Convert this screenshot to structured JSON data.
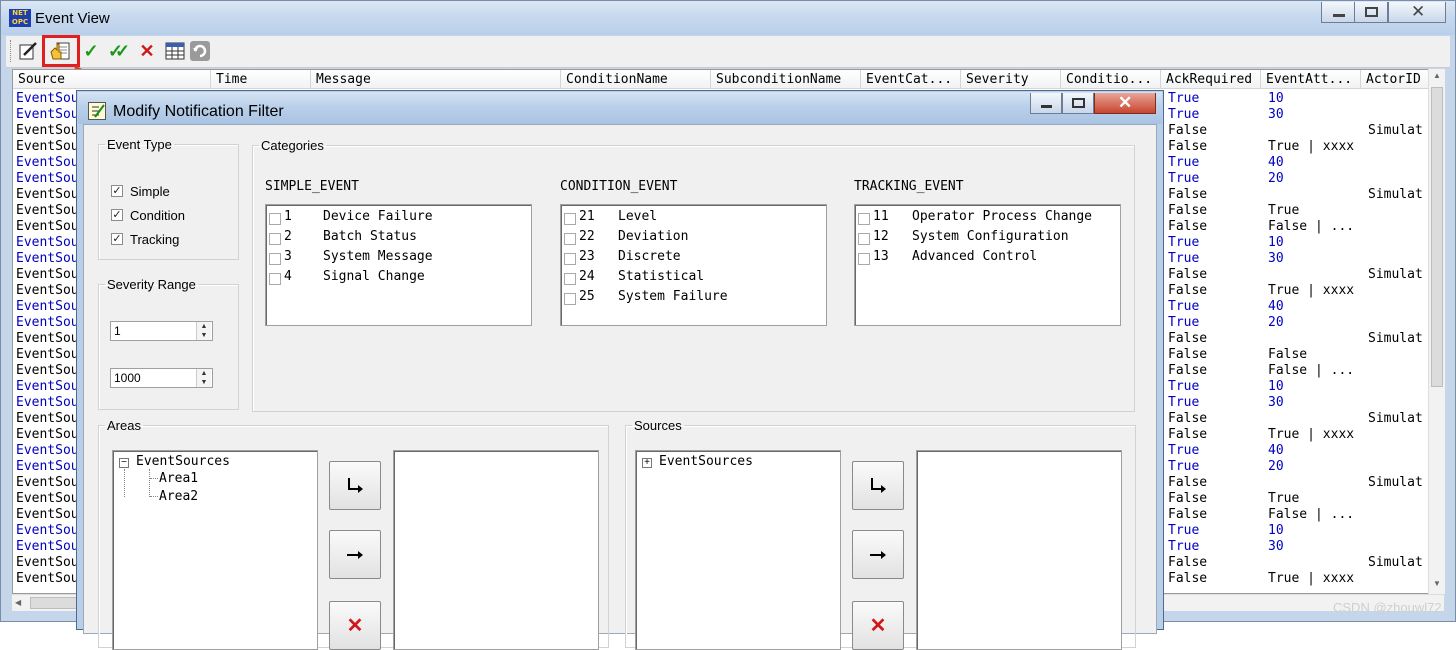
{
  "window": {
    "title": "Event View",
    "logo_text": "NET OPC",
    "minimize_icon": "minimize-icon",
    "maximize_icon": "maximize-icon",
    "close_icon": "close-icon"
  },
  "toolbar": {
    "icons": [
      "edit-icon",
      "filter-hand-icon",
      "check-icon",
      "double-check-icon",
      "delete-icon",
      "grid-icon",
      "refresh-icon"
    ]
  },
  "grid": {
    "columns": [
      "Source",
      "Time",
      "Message",
      "ConditionName",
      "SubconditionName",
      "EventCat...",
      "Severity",
      "Conditio...",
      "AckRequired",
      "EventAtt...",
      "ActorID"
    ],
    "rows": [
      {
        "source": "EventSou",
        "ack": "True",
        "attr": "10",
        "actor": "",
        "blue": true
      },
      {
        "source": "EventSou",
        "ack": "True",
        "attr": "30",
        "actor": "",
        "blue": true
      },
      {
        "source": "EventSou",
        "ack": "False",
        "attr": "",
        "actor": "Simulat",
        "blue": false
      },
      {
        "source": "EventSou",
        "ack": "False",
        "attr": "True | xxxx",
        "actor": "",
        "blue": false
      },
      {
        "source": "EventSou",
        "ack": "True",
        "attr": "40",
        "actor": "",
        "blue": true
      },
      {
        "source": "EventSou",
        "ack": "True",
        "attr": "20",
        "actor": "",
        "blue": true
      },
      {
        "source": "EventSou",
        "ack": "False",
        "attr": "",
        "actor": "Simulat",
        "blue": false
      },
      {
        "source": "EventSou",
        "ack": "False",
        "attr": "True",
        "actor": "",
        "blue": false
      },
      {
        "source": "EventSou",
        "ack": "False",
        "attr": "False | ...",
        "actor": "",
        "blue": false
      },
      {
        "source": "EventSou",
        "ack": "True",
        "attr": "10",
        "actor": "",
        "blue": true
      },
      {
        "source": "EventSou",
        "ack": "True",
        "attr": "30",
        "actor": "",
        "blue": true
      },
      {
        "source": "EventSou",
        "ack": "False",
        "attr": "",
        "actor": "Simulat",
        "blue": false
      },
      {
        "source": "EventSou",
        "ack": "False",
        "attr": "True | xxxx",
        "actor": "",
        "blue": false
      },
      {
        "source": "EventSou",
        "ack": "True",
        "attr": "40",
        "actor": "",
        "blue": true
      },
      {
        "source": "EventSou",
        "ack": "True",
        "attr": "20",
        "actor": "",
        "blue": true
      },
      {
        "source": "EventSou",
        "ack": "False",
        "attr": "",
        "actor": "Simulat",
        "blue": false
      },
      {
        "source": "EventSou",
        "ack": "False",
        "attr": "False",
        "actor": "",
        "blue": false
      },
      {
        "source": "EventSou",
        "ack": "False",
        "attr": "False | ...",
        "actor": "",
        "blue": false
      },
      {
        "source": "EventSou",
        "ack": "True",
        "attr": "10",
        "actor": "",
        "blue": true
      },
      {
        "source": "EventSou",
        "ack": "True",
        "attr": "30",
        "actor": "",
        "blue": true
      },
      {
        "source": "EventSou",
        "ack": "False",
        "attr": "",
        "actor": "Simulat",
        "blue": false
      },
      {
        "source": "EventSou",
        "ack": "False",
        "attr": "True | xxxx",
        "actor": "",
        "blue": false
      },
      {
        "source": "EventSou",
        "ack": "True",
        "attr": "40",
        "actor": "",
        "blue": true
      },
      {
        "source": "EventSou",
        "ack": "True",
        "attr": "20",
        "actor": "",
        "blue": true
      },
      {
        "source": "EventSou",
        "ack": "False",
        "attr": "",
        "actor": "Simulat",
        "blue": false
      },
      {
        "source": "EventSou",
        "ack": "False",
        "attr": "True",
        "actor": "",
        "blue": false
      },
      {
        "source": "EventSou",
        "ack": "False",
        "attr": "False | ...",
        "actor": "",
        "blue": false
      },
      {
        "source": "EventSou",
        "ack": "True",
        "attr": "10",
        "actor": "",
        "blue": true
      },
      {
        "source": "EventSou",
        "ack": "True",
        "attr": "30",
        "actor": "",
        "blue": true
      },
      {
        "source": "EventSou",
        "ack": "False",
        "attr": "",
        "actor": "Simulat",
        "blue": false
      },
      {
        "source": "EventSou",
        "ack": "False",
        "attr": "True | xxxx",
        "actor": "",
        "blue": false
      }
    ]
  },
  "dialog": {
    "title": "Modify Notification Filter",
    "event_type": {
      "legend": "Event Type",
      "options": [
        {
          "label": "Simple",
          "checked": true
        },
        {
          "label": "Condition",
          "checked": true
        },
        {
          "label": "Tracking",
          "checked": true
        }
      ]
    },
    "severity": {
      "legend": "Severity Range",
      "min": "1",
      "max": "1000"
    },
    "categories": {
      "legend": "Categories",
      "groups": [
        {
          "title": "SIMPLE_EVENT",
          "items": [
            {
              "id": "1",
              "name": "Device Failure"
            },
            {
              "id": "2",
              "name": "Batch Status"
            },
            {
              "id": "3",
              "name": "System Message"
            },
            {
              "id": "4",
              "name": "Signal Change"
            }
          ]
        },
        {
          "title": "CONDITION_EVENT",
          "items": [
            {
              "id": "21",
              "name": "Level"
            },
            {
              "id": "22",
              "name": "Deviation"
            },
            {
              "id": "23",
              "name": "Discrete"
            },
            {
              "id": "24",
              "name": "Statistical"
            },
            {
              "id": "25",
              "name": "System Failure"
            }
          ]
        },
        {
          "title": "TRACKING_EVENT",
          "items": [
            {
              "id": "11",
              "name": "Operator Process Change"
            },
            {
              "id": "12",
              "name": "System Configuration"
            },
            {
              "id": "13",
              "name": "Advanced Control"
            }
          ]
        }
      ]
    },
    "areas": {
      "legend": "Areas",
      "root": "EventSources",
      "children": [
        "Area1",
        "Area2"
      ]
    },
    "sources": {
      "legend": "Sources",
      "root": "EventSources"
    },
    "buttons": {
      "add_icon": "return-arrow-icon",
      "add_all_icon": "right-arrow-icon",
      "remove_icon": "red-x-icon"
    }
  },
  "watermark": "CSDN @zhouwl72"
}
